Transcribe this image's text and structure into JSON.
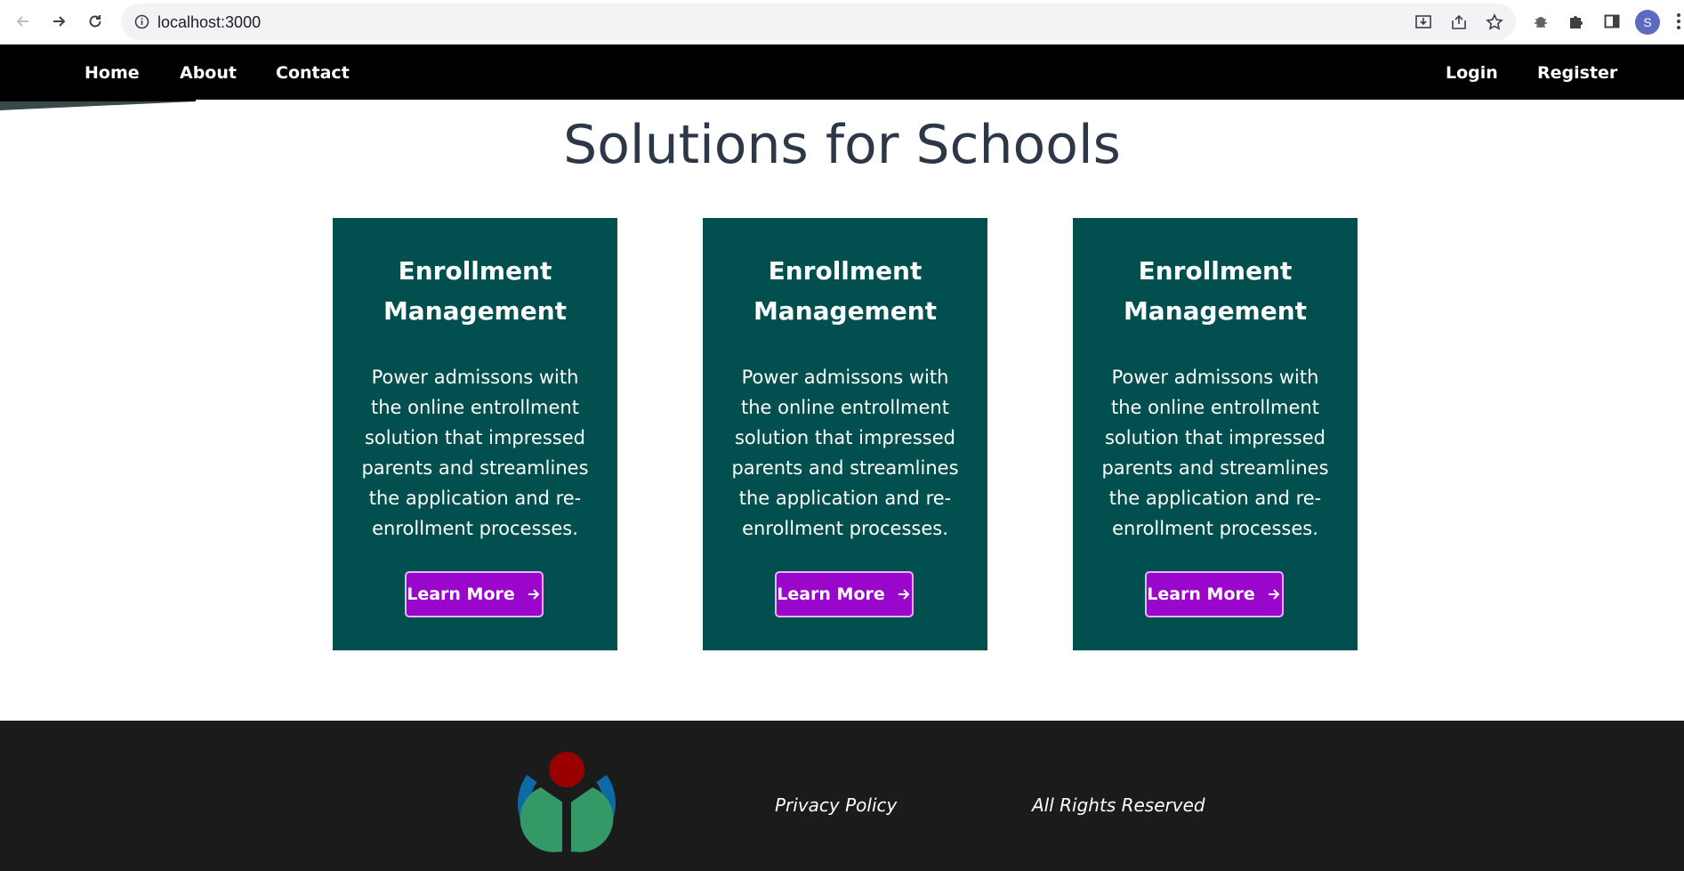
{
  "browser": {
    "url": "localhost:3000",
    "avatar_letter": "S"
  },
  "navbar": {
    "left_links": [
      "Home",
      "About",
      "Contact"
    ],
    "right_links": [
      "Login",
      "Register"
    ]
  },
  "hero": {
    "title": "Solutions for Schools"
  },
  "cards": [
    {
      "title_line1": "Enrollment",
      "title_line2": "Management",
      "body": "Power admissons with the online entrollment solution that impressed parents and streamlines the application and re-enrollment processes.",
      "button": "Learn More"
    },
    {
      "title_line1": "Enrollment",
      "title_line2": "Management",
      "body": "Power admissons with the online entrollment solution that impressed parents and streamlines the application and re-enrollment processes.",
      "button": "Learn More"
    },
    {
      "title_line1": "Enrollment",
      "title_line2": "Management",
      "body": "Power admissons with the online entrollment solution that impressed parents and streamlines the application and re-enrollment processes.",
      "button": "Learn More"
    }
  ],
  "footer": {
    "privacy": "Privacy Policy",
    "rights": "All Rights Reserved"
  },
  "colors": {
    "navbar_bg": "#000000",
    "card_bg": "#014f4f",
    "button_bg": "#9b06cc",
    "footer_bg": "#1b1b1b",
    "title_text": "#2d3748"
  },
  "icons": [
    "back-arrow-icon",
    "forward-arrow-icon",
    "reload-icon",
    "info-icon",
    "install-icon",
    "share-icon",
    "star-icon",
    "bug-extension-icon",
    "puzzle-extension-icon",
    "side-panel-icon",
    "kebab-menu-icon",
    "arrow-right-icon",
    "wikimedia-logo"
  ]
}
